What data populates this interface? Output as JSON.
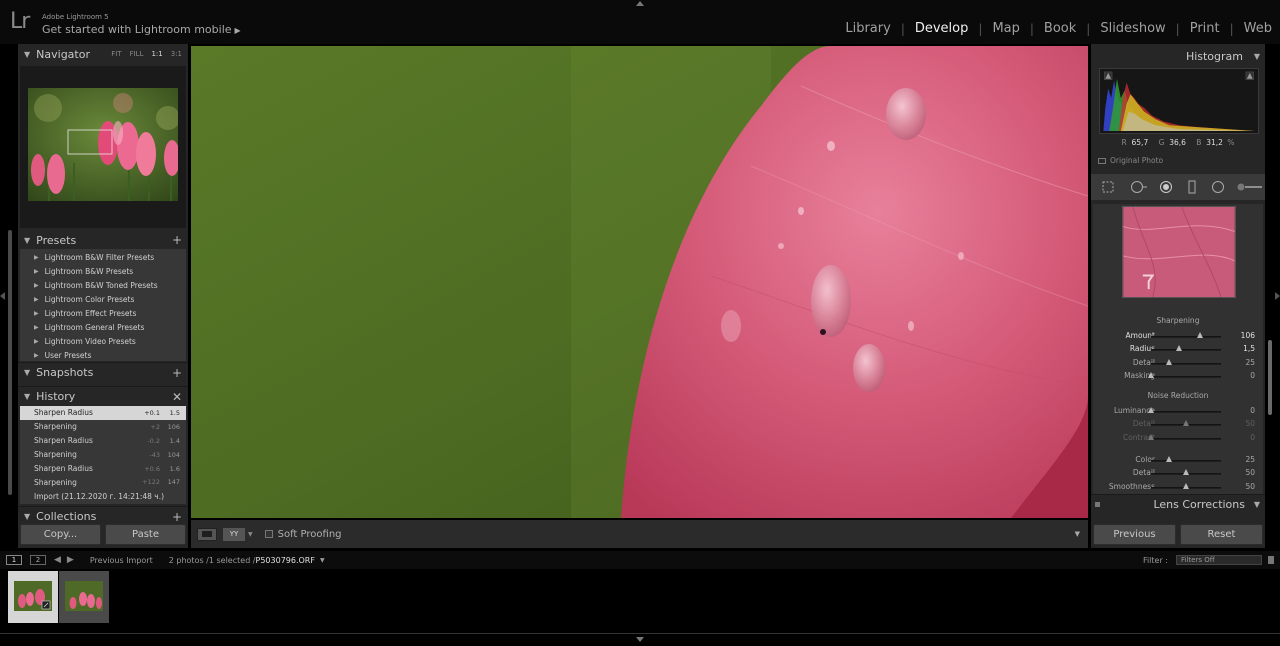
{
  "app": {
    "logo": "Lr",
    "name": "Adobe Lightroom 5",
    "mobile_link": "Get started with Lightroom mobile",
    "mobile_arrow": "▶"
  },
  "modules": [
    "Library",
    "Develop",
    "Map",
    "Book",
    "Slideshow",
    "Print",
    "Web"
  ],
  "active_module": "Develop",
  "navigator": {
    "title": "Navigator",
    "zoom_options": [
      "FIT",
      "FILL",
      "1:1",
      "3:1"
    ],
    "active_zoom": "1:1"
  },
  "presets": {
    "title": "Presets",
    "items": [
      "Lightroom B&W Filter Presets",
      "Lightroom B&W Presets",
      "Lightroom B&W Toned Presets",
      "Lightroom Color Presets",
      "Lightroom Effect Presets",
      "Lightroom General Presets",
      "Lightroom Video Presets",
      "User Presets"
    ]
  },
  "snapshots": {
    "title": "Snapshots"
  },
  "history": {
    "title": "History",
    "rows": [
      {
        "name": "Sharpen Radius",
        "delta": "+0.1",
        "value": "1.5",
        "selected": true
      },
      {
        "name": "Sharpening",
        "delta": "+2",
        "value": "106",
        "selected": false
      },
      {
        "name": "Sharpen Radius",
        "delta": "-0.2",
        "value": "1.4",
        "selected": false
      },
      {
        "name": "Sharpening",
        "delta": "-43",
        "value": "104",
        "selected": false
      },
      {
        "name": "Sharpen Radius",
        "delta": "+0.6",
        "value": "1.6",
        "selected": false
      },
      {
        "name": "Sharpening",
        "delta": "+122",
        "value": "147",
        "selected": false
      },
      {
        "name": "Import (21.12.2020 г. 14:21:48 ч.)",
        "delta": "",
        "value": "",
        "selected": false
      }
    ]
  },
  "collections": {
    "title": "Collections"
  },
  "left_buttons": {
    "copy": "Copy...",
    "paste": "Paste"
  },
  "toolbar": {
    "yy": "YY",
    "soft_proofing": "Soft Proofing"
  },
  "histogram": {
    "title": "Histogram",
    "readout": {
      "r_label": "R",
      "r": "65,7",
      "g_label": "G",
      "g": "36,6",
      "b_label": "B",
      "b": "31,2",
      "unit": "%"
    },
    "original_photo": "Original Photo"
  },
  "detail": {
    "sharpening": {
      "title": "Sharpening",
      "sliders": [
        {
          "label": "Amount",
          "value": "106",
          "pos": 0.7,
          "style": "bright"
        },
        {
          "label": "Radius",
          "value": "1,5",
          "pos": 0.4,
          "style": "bright"
        },
        {
          "label": "Detail",
          "value": "25",
          "pos": 0.25,
          "style": "normal"
        },
        {
          "label": "Masking",
          "value": "0",
          "pos": 0.0,
          "style": "normal"
        }
      ]
    },
    "noise_reduction": {
      "title": "Noise Reduction",
      "sliders": [
        {
          "label": "Luminance",
          "value": "0",
          "pos": 0.0,
          "style": "normal"
        },
        {
          "label": "Detail",
          "value": "50",
          "pos": 0.5,
          "style": "dim"
        },
        {
          "label": "Contrast",
          "value": "0",
          "pos": 0.0,
          "style": "dim"
        },
        {
          "label": "Color",
          "value": "25",
          "pos": 0.25,
          "style": "normal"
        },
        {
          "label": "Detail",
          "value": "50",
          "pos": 0.5,
          "style": "normal"
        },
        {
          "label": "Smoothness",
          "value": "50",
          "pos": 0.5,
          "style": "normal"
        }
      ]
    }
  },
  "lens_corrections": {
    "title": "Lens Corrections"
  },
  "right_buttons": {
    "previous": "Previous",
    "reset": "Reset"
  },
  "filmstrip": {
    "screen_1": "1",
    "screen_2": "2",
    "source": "Previous Import",
    "count": "2 photos /1 selected /",
    "filename": "P5030796.ORF",
    "filter_label": "Filter :",
    "filter_value": "Filters Off"
  },
  "colors": {
    "panel_bg": "#262626",
    "image_green": "#5a7a2a",
    "image_pink": "#d04a6a",
    "active_module": "#f0f0f0"
  }
}
